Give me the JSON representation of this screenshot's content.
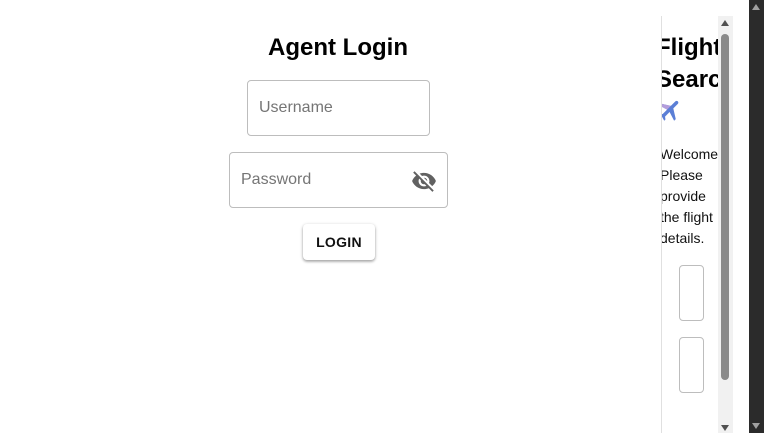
{
  "login": {
    "title": "Agent Login",
    "username_placeholder": "Username",
    "username_value": "",
    "password_placeholder": "Password",
    "password_value": "",
    "password_toggle_icon": "eye-off-icon",
    "login_label": "LOGIN"
  },
  "side_panel": {
    "title": "Flight Search",
    "icon": "airplane-icon",
    "welcome_text": "Welcome Please provide the flight details."
  },
  "colors": {
    "field_border": "#bdbdbd",
    "placeholder": "#757575",
    "plane_blue": "#5b7fd6",
    "plane_purple": "#b39ddb"
  }
}
